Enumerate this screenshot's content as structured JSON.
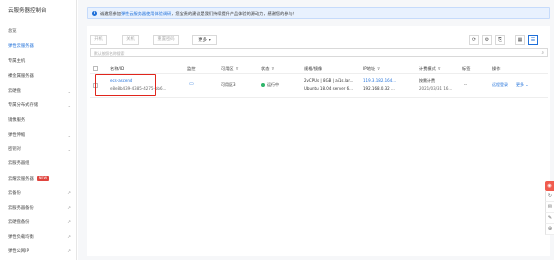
{
  "sidebar": {
    "title": "云服务器控制台",
    "items": [
      {
        "label": "总览",
        "active": false,
        "chevron": false
      },
      {
        "label": "弹性云服务器",
        "active": true,
        "chevron": false
      },
      {
        "label": "专属主机",
        "active": false,
        "chevron": false
      },
      {
        "label": "裸金属服务器",
        "active": false,
        "chevron": false
      },
      {
        "label": "云硬盘",
        "active": false,
        "chevron": true
      },
      {
        "label": "专属分布式存储",
        "active": false,
        "chevron": true
      },
      {
        "label": "镜像服务",
        "active": false,
        "chevron": false
      },
      {
        "label": "弹性伸缩",
        "active": false,
        "chevron": true
      },
      {
        "label": "密钥对",
        "active": false,
        "chevron": true
      },
      {
        "label": "云服务器组",
        "active": false,
        "chevron": false
      },
      {
        "label": "云耀云服务器",
        "active": false,
        "chevron": false,
        "badge": "NEW"
      },
      {
        "label": "云备份",
        "active": false,
        "ext": true
      },
      {
        "label": "云服务器备份",
        "active": false,
        "ext": true
      },
      {
        "label": "云硬盘备份",
        "active": false,
        "ext": true
      },
      {
        "label": "弹性负载均衡",
        "active": false,
        "ext": true
      },
      {
        "label": "弹性公网IP",
        "active": false,
        "ext": true
      }
    ]
  },
  "notice": {
    "prefix": "诚邀您参加",
    "link": "弹性云服务器使用体验调研",
    "suffix": "，您宝贵的建议是我们持续提升产品体验的源动力，感谢您的参与！"
  },
  "toolbar": {
    "start": "开机",
    "stop": "关机",
    "reset_password": "重置密码",
    "more": "更多"
  },
  "search": {
    "placeholder": "默认按照名称搜索"
  },
  "table": {
    "headers": {
      "name": "名称/ID",
      "monitor": "监控",
      "zone": "可用区",
      "status": "状态",
      "spec": "规格/镜像",
      "ip": "IP地址",
      "billing": "计费模式",
      "tags": "标签",
      "actions": "操作"
    },
    "rows": [
      {
        "name": "ecs-ascend",
        "id": "e8e8b439-4385-4275-bb6...",
        "zone": "可用区3",
        "status": "运行中",
        "spec_line1": "2vCPUs | 8GB | ai1s.lar...",
        "spec_line2": "Ubuntu 18.04 server 6...",
        "ip_line1": "119.3.182.164...",
        "ip_line2": "192.168.0.32 ...",
        "billing_line1": "按需计费",
        "billing_line2": "2021/03/31 16...",
        "tags": "--",
        "action_remote": "远程登录",
        "action_more": "更多"
      }
    ]
  }
}
